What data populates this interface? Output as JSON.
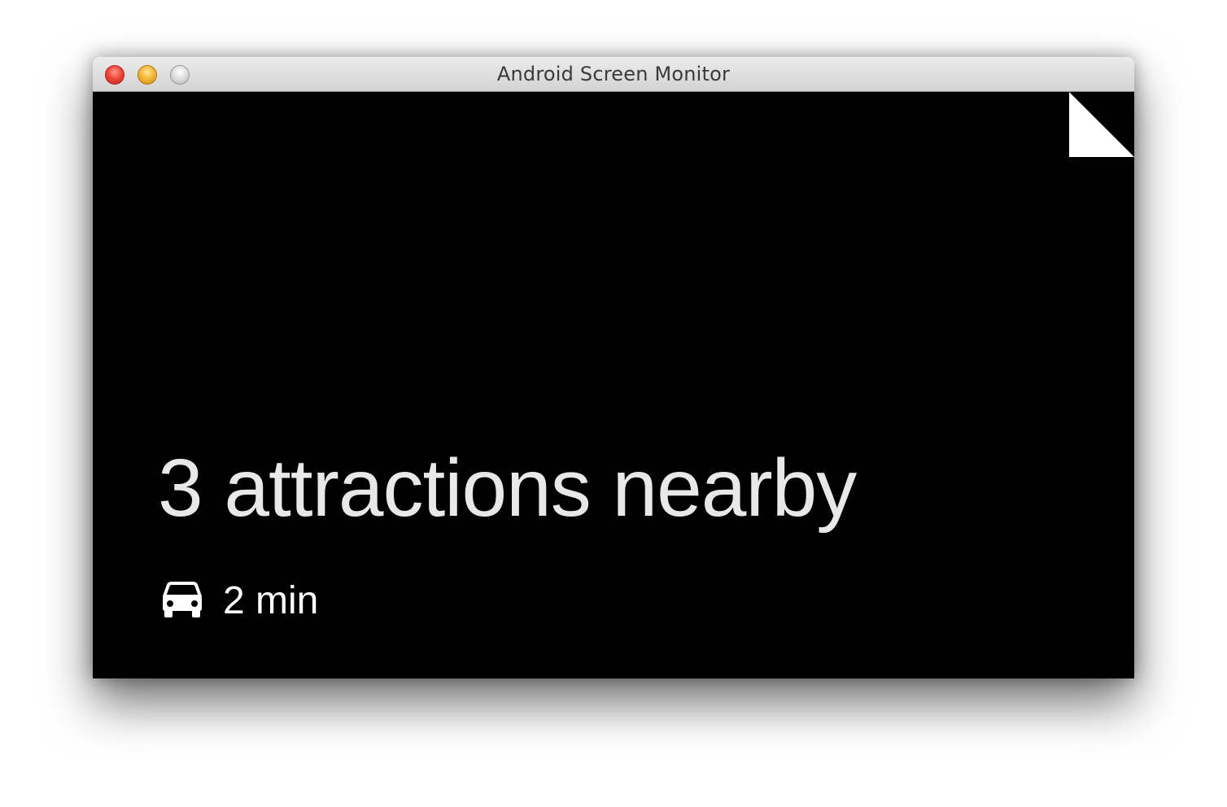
{
  "window": {
    "title": "Android Screen Monitor",
    "controls": [
      "close",
      "minimize",
      "zoom"
    ]
  },
  "card": {
    "headline": "3 attractions nearby",
    "travel": {
      "icon": "car-icon",
      "duration": "2 min"
    },
    "corner": "page-fold-icon"
  },
  "colors": {
    "screen_bg": "#000000",
    "text": "#ffffff",
    "close": "#f0473b",
    "minimize": "#f5b83a",
    "zoom": "#c8c8c8"
  }
}
